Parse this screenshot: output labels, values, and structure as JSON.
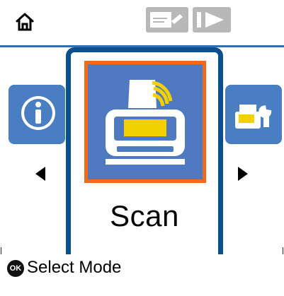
{
  "screen": {
    "mode_label": "Scan"
  },
  "footer": {
    "ok_key": "OK",
    "hint_text": "Select Mode"
  },
  "icons": {
    "home": "home-icon",
    "status_a": "paper-print-icon",
    "status_b": "play-icon",
    "left_tile": "info-icon",
    "right_tile": "maintenance-icon",
    "center_tile": "scanner-icon",
    "prev": "arrow-left-icon",
    "next": "arrow-right-icon"
  },
  "colors": {
    "focus_border": "#0b4f8f",
    "selection_border": "#f26b1d",
    "tile_blue": "#4f7ac2",
    "accent_yellow": "#f3d000",
    "header_line": "#2f6fb6"
  }
}
